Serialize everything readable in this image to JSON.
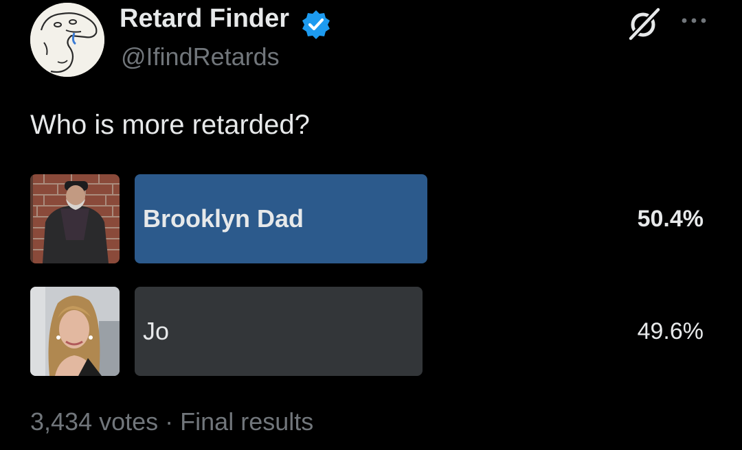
{
  "author": {
    "display_name": "Retard Finder",
    "handle": "@IfindRetards",
    "verified": true
  },
  "tweet": {
    "text": "Who is more retarded?"
  },
  "poll": {
    "options": [
      {
        "label": "Brooklyn Dad",
        "percent_text": "50.4%",
        "percent": 50.4,
        "winner": true
      },
      {
        "label": "Jo",
        "percent_text": "49.6%",
        "percent": 49.6,
        "winner": false
      }
    ],
    "votes_text": "3,434 votes",
    "separator": "·",
    "status_text": "Final results"
  },
  "colors": {
    "background": "#000000",
    "text": "#e7e9ea",
    "muted": "#71767b",
    "winner_bar": "#2c5a8c",
    "loser_bar": "#333639",
    "verified": "#1d9bf0"
  },
  "icons": {
    "verified": "verified-badge-icon",
    "grok": "grok-icon",
    "more": "more-options-icon"
  }
}
